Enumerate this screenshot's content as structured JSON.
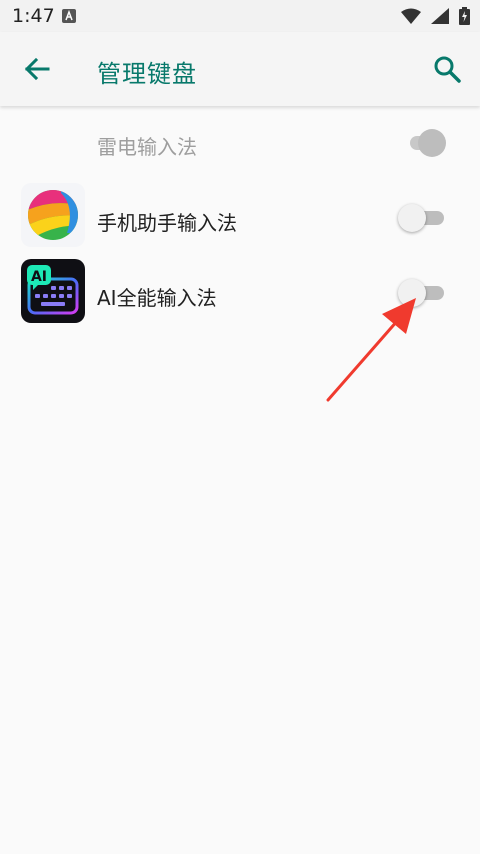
{
  "status_bar": {
    "time": "1:47",
    "icons": [
      "notification-a-icon",
      "wifi-icon",
      "cell-signal-icon",
      "battery-charging-icon"
    ]
  },
  "header": {
    "title": "管理键盘",
    "back_icon": "arrow-left-icon",
    "search_icon": "search-icon"
  },
  "keyboards": [
    {
      "label": "雷电输入法",
      "enabled_state": true,
      "disabled": true,
      "icon": null
    },
    {
      "label": "手机助手输入法",
      "enabled_state": false,
      "disabled": false,
      "icon": "rainbow-ball-icon"
    },
    {
      "label": "AI全能输入法",
      "enabled_state": false,
      "disabled": false,
      "icon": "ai-keyboard-icon",
      "icon_text": "AI"
    }
  ],
  "colors": {
    "accent": "#08796b",
    "annotation_arrow": "#f03a2e"
  }
}
